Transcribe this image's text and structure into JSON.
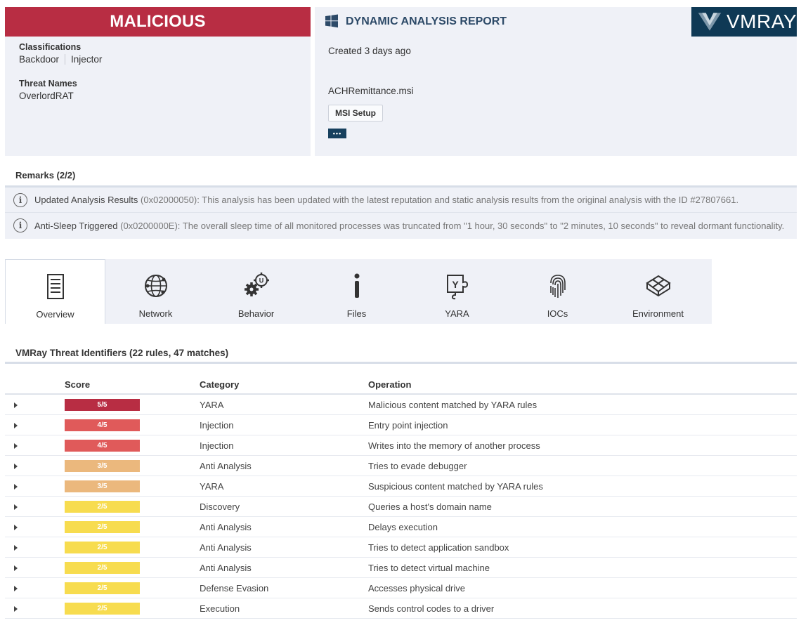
{
  "verdict": {
    "label": "MALICIOUS",
    "color": "#b82d43",
    "classifications_label": "Classifications",
    "classifications": [
      "Backdoor",
      "Injector"
    ],
    "threat_names_label": "Threat Names",
    "threat_names": [
      "OverlordRAT"
    ]
  },
  "report": {
    "title": "DYNAMIC ANALYSIS REPORT",
    "title_icon": "windows-icon",
    "brand": "VMRAY",
    "created": "Created 3 days ago",
    "filename": "ACHRemittance.msi",
    "filetype": "MSI Setup",
    "more_label": "•••"
  },
  "remarks": {
    "title": "Remarks (2/2)",
    "items": [
      {
        "title": "Updated Analysis Results",
        "detail": " (0x02000050): This analysis has been updated with the latest reputation and static analysis results from the original analysis with the ID #27807661."
      },
      {
        "title": "Anti-Sleep Triggered",
        "detail": " (0x0200000E): The overall sleep time of all monitored processes was truncated from \"1 hour, 30 seconds\" to \"2 minutes, 10 seconds\" to reveal dormant functionality."
      }
    ]
  },
  "tabs": [
    {
      "label": "Overview",
      "icon": "document-icon",
      "active": true
    },
    {
      "label": "Network",
      "icon": "globe-icon",
      "active": false
    },
    {
      "label": "Behavior",
      "icon": "gears-icon",
      "active": false
    },
    {
      "label": "Files",
      "icon": "info-file-icon",
      "active": false
    },
    {
      "label": "YARA",
      "icon": "yara-icon",
      "active": false
    },
    {
      "label": "IOCs",
      "icon": "fingerprint-icon",
      "active": false
    },
    {
      "label": "Environment",
      "icon": "cube-icon",
      "active": false
    }
  ],
  "threat_identifiers": {
    "title": "VMRay Threat Identifiers (22 rules, 47 matches)",
    "columns": {
      "score": "Score",
      "category": "Category",
      "operation": "Operation"
    },
    "score_colors": {
      "5": "#b82d43",
      "4": "#e05a5a",
      "3": "#ebb87d",
      "2": "#f7dc4f"
    },
    "rows": [
      {
        "score": "5/5",
        "level": 5,
        "category": "YARA",
        "operation": "Malicious content matched by YARA rules"
      },
      {
        "score": "4/5",
        "level": 4,
        "category": "Injection",
        "operation": "Entry point injection"
      },
      {
        "score": "4/5",
        "level": 4,
        "category": "Injection",
        "operation": "Writes into the memory of another process"
      },
      {
        "score": "3/5",
        "level": 3,
        "category": "Anti Analysis",
        "operation": "Tries to evade debugger"
      },
      {
        "score": "3/5",
        "level": 3,
        "category": "YARA",
        "operation": "Suspicious content matched by YARA rules"
      },
      {
        "score": "2/5",
        "level": 2,
        "category": "Discovery",
        "operation": "Queries a host's domain name"
      },
      {
        "score": "2/5",
        "level": 2,
        "category": "Anti Analysis",
        "operation": "Delays execution"
      },
      {
        "score": "2/5",
        "level": 2,
        "category": "Anti Analysis",
        "operation": "Tries to detect application sandbox"
      },
      {
        "score": "2/5",
        "level": 2,
        "category": "Anti Analysis",
        "operation": "Tries to detect virtual machine"
      },
      {
        "score": "2/5",
        "level": 2,
        "category": "Defense Evasion",
        "operation": "Accesses physical drive"
      },
      {
        "score": "2/5",
        "level": 2,
        "category": "Execution",
        "operation": "Sends control codes to a driver"
      }
    ]
  }
}
